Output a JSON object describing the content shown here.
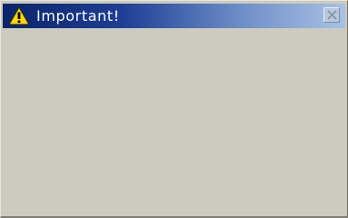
{
  "dialog": {
    "title": "Important!",
    "icon": "warning-icon",
    "close_icon": "close-icon"
  },
  "colors": {
    "titlebar_start": "#0a246a",
    "titlebar_end": "#a8c2e4",
    "body": "#cccbbe",
    "icon_yellow": "#ffd800"
  }
}
